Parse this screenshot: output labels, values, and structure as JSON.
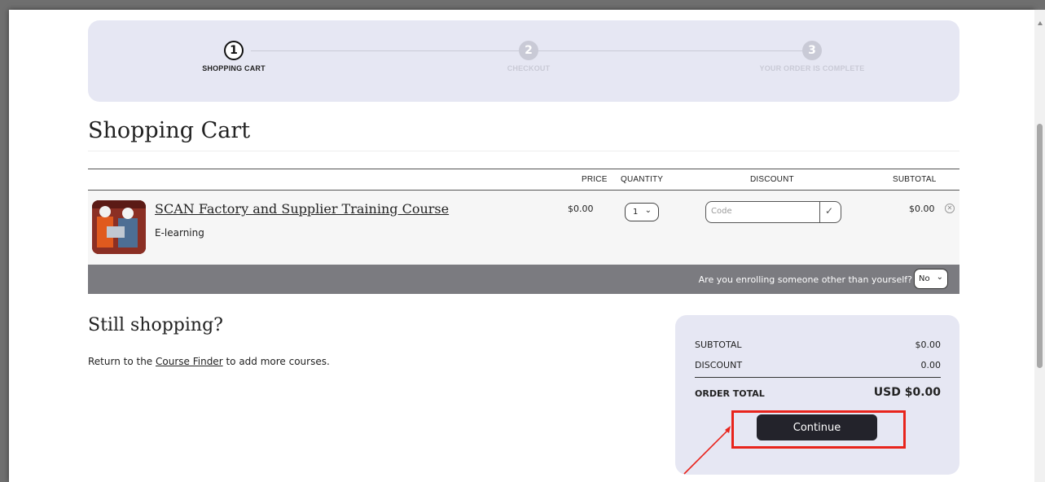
{
  "steps": [
    {
      "number": "1",
      "label": "SHOPPING CART",
      "state": "active"
    },
    {
      "number": "2",
      "label": "CHECKOUT",
      "state": "inactive"
    },
    {
      "number": "3",
      "label": "YOUR ORDER IS COMPLETE",
      "state": "inactive"
    }
  ],
  "page_title": "Shopping Cart",
  "table": {
    "headers": {
      "price": "PRICE",
      "quantity": "QUANTITY",
      "discount": "DISCOUNT",
      "subtotal": "SUBTOTAL"
    },
    "item": {
      "name": "SCAN Factory and Supplier Training Course",
      "type": "E-learning",
      "price": "$0.00",
      "quantity": "1",
      "discount_placeholder": "Code",
      "subtotal": "$0.00"
    }
  },
  "enroll": {
    "question": "Are you enrolling someone other than yourself?",
    "value": "No"
  },
  "still_shopping": {
    "title": "Still shopping?",
    "text_before": "Return to the ",
    "link": "Course Finder",
    "text_after": " to add more courses."
  },
  "summary": {
    "subtotal_label": "SUBTOTAL",
    "subtotal_value": "$0.00",
    "discount_label": "DISCOUNT",
    "discount_value": "0.00",
    "total_label": "ORDER TOTAL",
    "total_value": "USD $0.00",
    "continue_label": "Continue"
  },
  "colors": {
    "accent_panel": "#e6e7f3",
    "button": "#23232b",
    "highlight": "#e8241c",
    "enroll_bar": "#7b7b80"
  },
  "icons": {
    "quantity": "chevron-down-icon",
    "discount": "check-icon",
    "remove": "close-circle-icon",
    "enroll": "chevron-down-icon"
  }
}
